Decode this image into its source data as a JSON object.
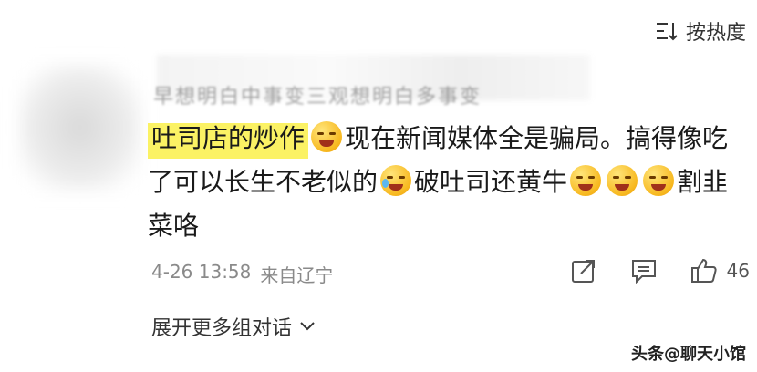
{
  "sort": {
    "label": "按热度",
    "icon": "sort-icon"
  },
  "author": {
    "name_fragment": "早想明白中事变三观想明白多事变"
  },
  "comment": {
    "segments": [
      {
        "type": "text",
        "text": "吐司店的炒作",
        "highlight": true
      },
      {
        "type": "emoji",
        "name": "smirk-emoji"
      },
      {
        "type": "text",
        "text": "现在新闻媒体全是骗局。搞",
        "highlight": false
      },
      {
        "type": "text",
        "text": "得像吃了可以长生不老似的",
        "highlight": false
      },
      {
        "type": "emoji",
        "name": "laugh-cry-emoji"
      },
      {
        "type": "text",
        "text": "破吐司还黄牛",
        "highlight": false
      },
      {
        "type": "emoji",
        "name": "drool-emoji"
      },
      {
        "type": "emoji",
        "name": "drool-emoji"
      },
      {
        "type": "emoji",
        "name": "drool-emoji"
      },
      {
        "type": "text",
        "text": "割韭菜咯",
        "highlight": false
      }
    ],
    "highlight_color": "#fbf264"
  },
  "meta": {
    "date": "4-26 13:58",
    "source": "来自辽宁"
  },
  "actions": {
    "share_icon": "share-icon",
    "comment_icon": "comment-icon",
    "like_icon": "thumbs-up-icon",
    "like_count": "46"
  },
  "expand": {
    "label": "展开更多组对话"
  },
  "watermark": {
    "text": "头条@聊天小馆"
  }
}
